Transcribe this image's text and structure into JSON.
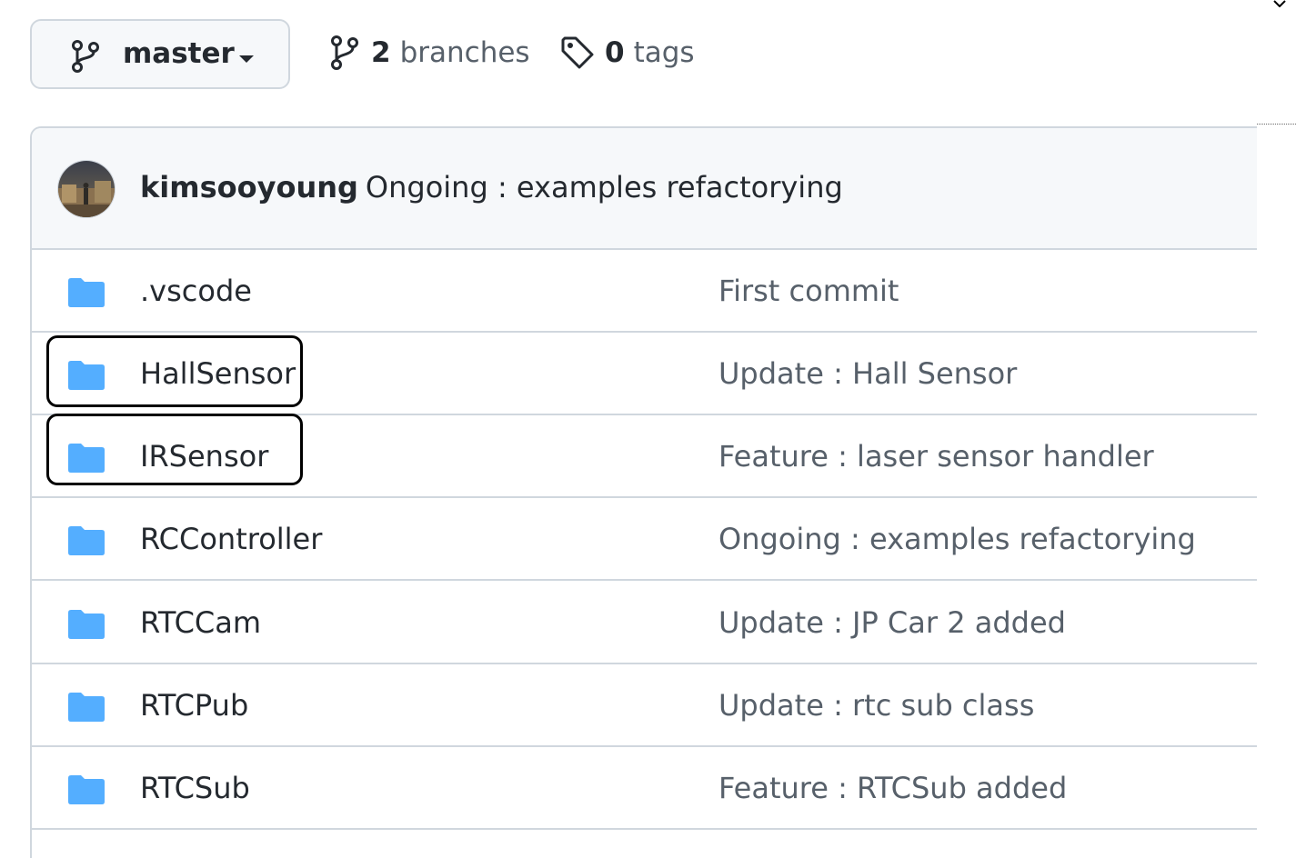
{
  "branch_selector": {
    "branch_name": "master",
    "branch_icon": "git-branch-icon",
    "caret_icon": "caret-down-icon"
  },
  "stats": {
    "branches_count": "2",
    "branches_label": "branches",
    "tags_count": "0",
    "tags_label": "tags"
  },
  "latest_commit": {
    "author": "kimsooyoung",
    "message": "Ongoing : examples refactorying"
  },
  "files": [
    {
      "name": ".vscode",
      "message": "First commit",
      "icon": "folder-icon"
    },
    {
      "name": "HallSensor",
      "message": "Update : Hall Sensor",
      "icon": "folder-icon"
    },
    {
      "name": "IRSensor",
      "message": "Feature : laser sensor handler",
      "icon": "folder-icon"
    },
    {
      "name": "RCController",
      "message": "Ongoing : examples refactorying",
      "icon": "folder-icon"
    },
    {
      "name": "RTCCam",
      "message": "Update : JP Car 2 added",
      "icon": "folder-icon"
    },
    {
      "name": "RTCPub",
      "message": "Update : rtc sub class",
      "icon": "folder-icon"
    },
    {
      "name": "RTCSub",
      "message": "Feature : RTCSub added",
      "icon": "folder-icon"
    }
  ],
  "colors": {
    "folder": "#54aeff",
    "border": "#d0d7de",
    "header_bg": "#f6f8fa",
    "muted_text": "#57606a",
    "highlight": "#000000"
  }
}
